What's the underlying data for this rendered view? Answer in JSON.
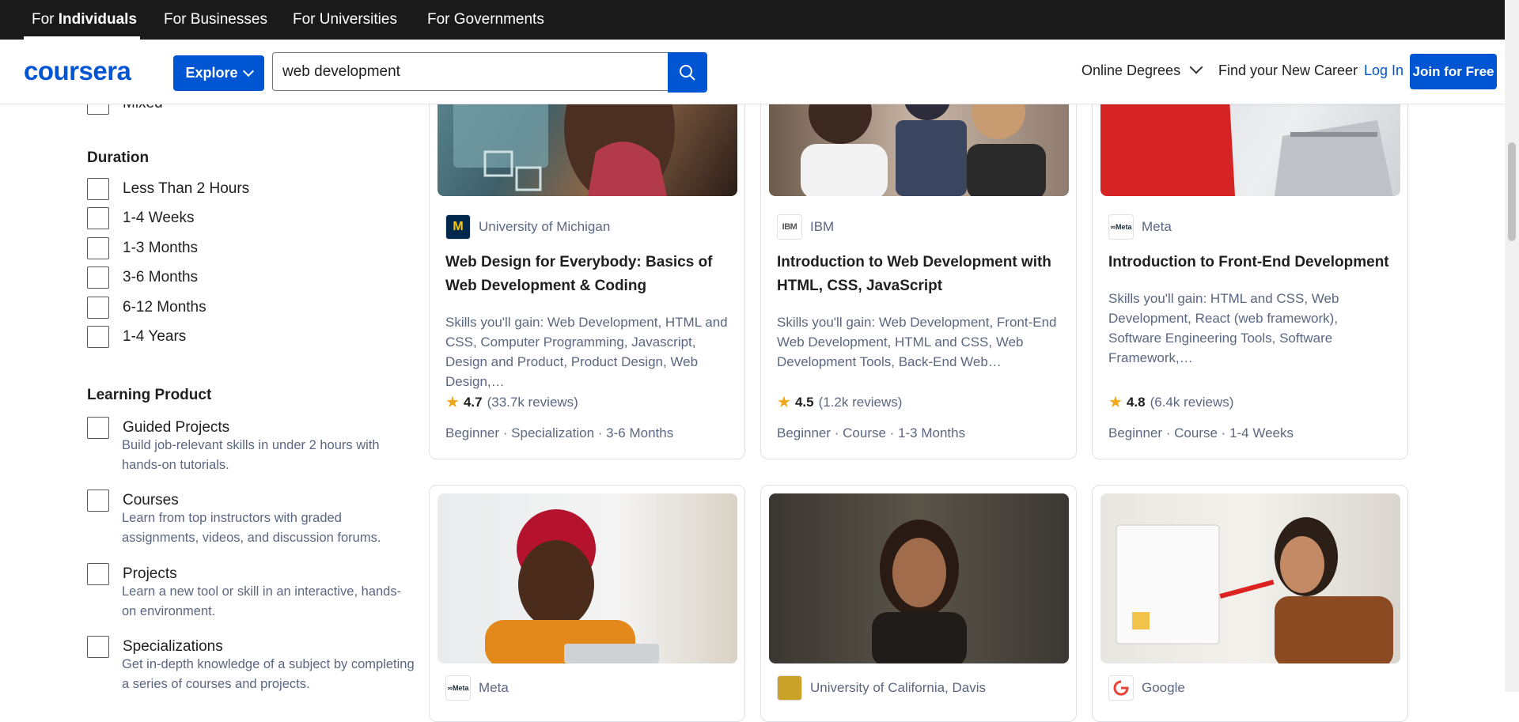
{
  "topbar": {
    "items": [
      {
        "pre": "For ",
        "bold": "Individuals"
      },
      {
        "label": "For Businesses"
      },
      {
        "label": "For Universities"
      },
      {
        "label": "For Governments"
      }
    ]
  },
  "header": {
    "logo": "coursera",
    "explore_label": "Explore",
    "search_value": "web development",
    "online_degrees": "Online Degrees",
    "find_career": "Find your New Career",
    "login": "Log In",
    "join": "Join for Free"
  },
  "sidebar": {
    "partial_option": "Mixed",
    "duration": {
      "title": "Duration",
      "options": [
        "Less Than 2 Hours",
        "1-4 Weeks",
        "1-3 Months",
        "3-6 Months",
        "6-12 Months",
        "1-4 Years"
      ]
    },
    "learning_product": {
      "title": "Learning Product",
      "options": [
        {
          "label": "Guided Projects",
          "desc": "Build job-relevant skills in under 2 hours with hands-on tutorials."
        },
        {
          "label": "Courses",
          "desc": "Learn from top instructors with graded assignments, videos, and discussion forums."
        },
        {
          "label": "Projects",
          "desc": "Learn a new tool or skill in an interactive, hands-on environment."
        },
        {
          "label": "Specializations",
          "desc": "Get in-depth knowledge of a subject by completing a series of courses and projects."
        }
      ]
    }
  },
  "cards": [
    {
      "partner": "University of Michigan",
      "title": "Web Design for Everybody: Basics of Web Development & Coding",
      "skills": "Skills you'll gain: Web Development, HTML and CSS, Computer Programming, Javascript, Design and Product, Product Design, Web Design,…",
      "rating": "4.7",
      "reviews": "(33.7k reviews)",
      "meta": "Beginner · Specialization · 3-6 Months"
    },
    {
      "partner": "IBM",
      "title": "Introduction to Web Development with HTML, CSS, JavaScript",
      "skills": "Skills you'll gain: Web Development, Front-End Web Development, HTML and CSS, Web Development Tools, Back-End Web…",
      "rating": "4.5",
      "reviews": "(1.2k reviews)",
      "meta": "Beginner · Course · 1-3 Months"
    },
    {
      "partner": "Meta",
      "title": "Introduction to Front-End Development",
      "skills": "Skills you'll gain: HTML and CSS, Web Development, React (web framework), Software Engineering Tools, Software Framework,…",
      "rating": "4.8",
      "reviews": "(6.4k reviews)",
      "meta": "Beginner · Course · 1-4 Weeks"
    },
    {
      "partner": "Meta"
    },
    {
      "partner": "University of California, Davis"
    },
    {
      "partner": "Google"
    }
  ],
  "logos": {
    "michigan": "M",
    "ibm": "IBM",
    "meta": "∞Meta"
  },
  "colors": {
    "brand": "#0056d2",
    "topbar": "#1a1a1a",
    "star": "#f0a71a"
  }
}
